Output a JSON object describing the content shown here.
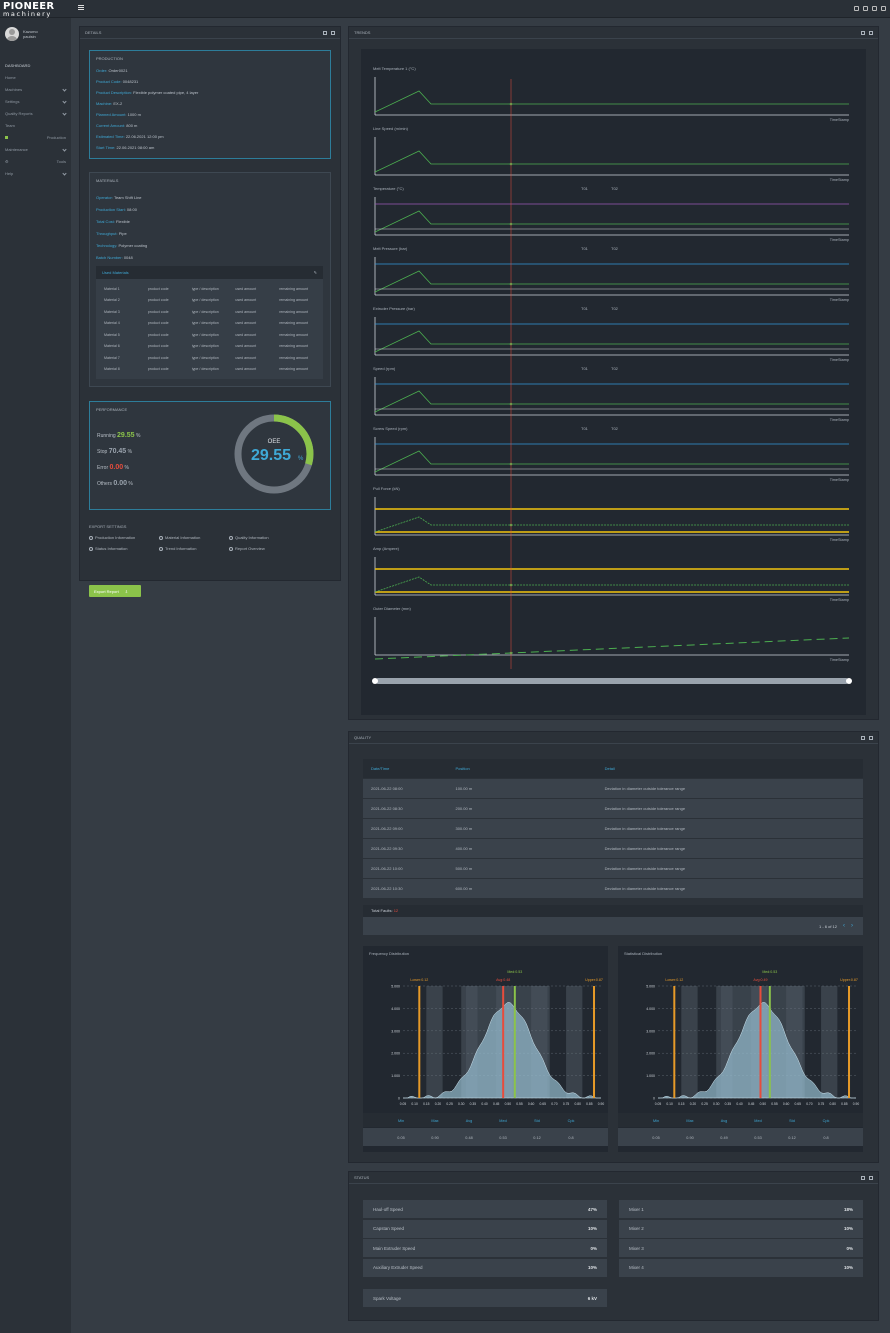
{
  "brand": {
    "line1": "PIONEER",
    "line2": "machinery"
  },
  "user": {
    "name_line1": "Kazumo",
    "name_line2": "paulsin"
  },
  "sidebar": {
    "items": [
      {
        "label": "DASHBOARD",
        "kind": "section"
      },
      {
        "label": "Home"
      },
      {
        "label": "Machines",
        "chev": true
      },
      {
        "label": "Settings",
        "chev": true
      },
      {
        "label": "Quality Reports",
        "chev": true
      },
      {
        "label": "Team"
      },
      {
        "label": "Production",
        "kind": "active"
      },
      {
        "label": "Maintenance",
        "chev": true
      },
      {
        "label": "Tools",
        "kind": "gear"
      },
      {
        "label": "Help",
        "chev": true
      }
    ]
  },
  "panels": {
    "details": "DETAILS",
    "trends": "TRENDS",
    "quality": "QUALITY",
    "status": "STATUS"
  },
  "production": {
    "title": "PRODUCTION",
    "rows": [
      {
        "k": "Order:",
        "v": "Order0021"
      },
      {
        "k": "Product Code:",
        "v": "0048231"
      },
      {
        "k": "Product Description:",
        "v": "Flexible polymer coated pipe, 4 layer"
      },
      {
        "k": "Machine:",
        "v": "EX-2"
      },
      {
        "k": "Planned Amount:",
        "v": "1000 m"
      },
      {
        "k": "Current Amount:",
        "v": "800 m"
      },
      {
        "k": "Estimated Time:",
        "v": "22.06.2021 12:00 pm"
      },
      {
        "k": "Start Time:",
        "v": "22.06.2021 08:00 am"
      }
    ]
  },
  "materials": {
    "title": "MATERIALS",
    "rows": [
      {
        "k": "Operator:",
        "v": "Team Shift Line"
      },
      {
        "k": "Production Start:",
        "v": "08:00"
      },
      {
        "k": "Total Cost:",
        "v": "Flexible"
      },
      {
        "k": "Throughput:",
        "v": "Pipe"
      },
      {
        "k": "Technology:",
        "v": "Polymer coating"
      },
      {
        "k": "Batch Number:",
        "v": "0048"
      }
    ],
    "table_title": "Used Materials",
    "table_rows": [
      [
        "Material 1",
        "product code",
        "type / description",
        "used amount",
        "remaining amount"
      ],
      [
        "Material 2",
        "product code",
        "type / description",
        "used amount",
        "remaining amount"
      ],
      [
        "Material 3",
        "product code",
        "type / description",
        "used amount",
        "remaining amount"
      ],
      [
        "Material 4",
        "product code",
        "type / description",
        "used amount",
        "remaining amount"
      ],
      [
        "Material 5",
        "product code",
        "type / description",
        "used amount",
        "remaining amount"
      ],
      [
        "Material 6",
        "product code",
        "type / description",
        "used amount",
        "remaining amount"
      ],
      [
        "Material 7",
        "product code",
        "type / description",
        "used amount",
        "remaining amount"
      ],
      [
        "Material 8",
        "product code",
        "type / description",
        "used amount",
        "remaining amount"
      ]
    ]
  },
  "performance": {
    "title": "PERFORMANCE",
    "rows": [
      {
        "k": "Running",
        "v": "29.55",
        "u": "%",
        "color": "#8bc34a"
      },
      {
        "k": "Stop",
        "v": "70.45",
        "u": "%",
        "color": "#9aa3ad"
      },
      {
        "k": "Error",
        "v": "0.00",
        "u": "%",
        "color": "#e74c3c"
      },
      {
        "k": "Others",
        "v": "0.00",
        "u": "%",
        "color": "#9aa3ad"
      }
    ],
    "oee_label": "OEE",
    "oee_value": "29.55",
    "oee_unit": "%",
    "oee_fraction": 0.2955
  },
  "export": {
    "title": "EXPORT SETTINGS",
    "options": [
      "Production Information",
      "Material Information",
      "Quality Information",
      "Status Information",
      "Trend Information",
      "Report Overview"
    ],
    "button": "Export Report"
  },
  "trends": {
    "charts": [
      {
        "label": "Melt Temperature 1 (°C)",
        "type": "single"
      },
      {
        "label": "Line Speed (m/min)",
        "type": "single"
      },
      {
        "label": "Temperature (°C)",
        "type": "multi",
        "legend": [
          "T01",
          "T02"
        ]
      },
      {
        "label": "Melt Pressure (bar)",
        "type": "multi",
        "legend": [
          "T01",
          "T02"
        ]
      },
      {
        "label": "Extruder Pressure (bar)",
        "type": "multi",
        "legend": [
          "T01",
          "T02"
        ]
      },
      {
        "label": "Speed (rpm)",
        "type": "multi",
        "legend": [
          "T01",
          "T02"
        ]
      },
      {
        "label": "Screw Speed (rpm)",
        "type": "multi",
        "legend": [
          "T01",
          "T02"
        ]
      },
      {
        "label": "Pull Force (kN)",
        "type": "yellow"
      },
      {
        "label": "Amp (Ampere)",
        "type": "yellow"
      },
      {
        "label": "Outer Diameter (mm)",
        "type": "dash"
      }
    ],
    "xlabel": "TimeStamp"
  },
  "quality": {
    "headers": [
      "Date/Time",
      "Position",
      "Detail"
    ],
    "rows": [
      [
        "2021-06-22 08:00",
        "100.00 m",
        "Deviation in diameter outside tolerance range"
      ],
      [
        "2021-06-22 08:30",
        "200.00 m",
        "Deviation in diameter outside tolerance range"
      ],
      [
        "2021-06-22 09:00",
        "300.00 m",
        "Deviation in diameter outside tolerance range"
      ],
      [
        "2021-06-22 09:30",
        "400.00 m",
        "Deviation in diameter outside tolerance range"
      ],
      [
        "2021-06-22 10:00",
        "500.00 m",
        "Deviation in diameter outside tolerance range"
      ],
      [
        "2021-06-22 10:30",
        "600.00 m",
        "Deviation in diameter outside tolerance range"
      ]
    ],
    "total_label": "Total Faults:",
    "total_value": "12",
    "pagination": "1 - 6 of 12"
  },
  "chart_data": [
    {
      "type": "area",
      "title": "Frequency Distribution",
      "annotations": [
        "Lower:0.12",
        "Avg:0.48",
        "Med:0.53",
        "Upper:0.87"
      ],
      "yticks": [
        "5.000",
        "4.000",
        "3.000",
        "2.000",
        "1.000",
        "0"
      ],
      "xticks": [
        "0.05",
        "0.10",
        "0.15",
        "0.20",
        "0.25",
        "0.30",
        "0.35",
        "0.40",
        "0.45",
        "0.50",
        "0.55",
        "0.60",
        "0.65",
        "0.70",
        "0.75",
        "0.80",
        "0.85",
        "0.90"
      ],
      "stats_headers": [
        "Min",
        "Max",
        "Avg",
        "Med",
        "Std",
        "Cpk"
      ],
      "stats_values": [
        "0.05",
        "0.90",
        "0.48",
        "0.53",
        "0.12",
        "0.8"
      ]
    },
    {
      "type": "area",
      "title": "Statistical Distribution",
      "annotations": [
        "Lower:0.12",
        "Avg:0.49",
        "Med:0.53",
        "Upper:0.87"
      ],
      "yticks": [
        "5.000",
        "4.000",
        "3.000",
        "2.000",
        "1.000",
        "0"
      ],
      "xticks": [
        "0.05",
        "0.10",
        "0.15",
        "0.20",
        "0.25",
        "0.30",
        "0.35",
        "0.40",
        "0.45",
        "0.50",
        "0.55",
        "0.60",
        "0.65",
        "0.70",
        "0.75",
        "0.80",
        "0.85",
        "0.90"
      ],
      "stats_headers": [
        "Min",
        "Max",
        "Avg",
        "Med",
        "Std",
        "Cpk"
      ],
      "stats_values": [
        "0.05",
        "0.90",
        "0.49",
        "0.53",
        "0.12",
        "0.8"
      ]
    }
  ],
  "status": {
    "left": [
      {
        "k": "Haul-off Speed",
        "v": "47%"
      },
      {
        "k": "Capstan Speed",
        "v": "10%"
      },
      {
        "k": "Main Extruder Speed",
        "v": "0%"
      },
      {
        "k": "Auxiliary Extruder Speed",
        "v": "10%"
      }
    ],
    "right": [
      {
        "k": "Mixer 1",
        "v": "18%"
      },
      {
        "k": "Mixer 2",
        "v": "10%"
      },
      {
        "k": "Mixer 3",
        "v": "0%"
      },
      {
        "k": "Mixer 4",
        "v": "10%"
      }
    ],
    "extra": {
      "k": "Spark Voltage",
      "v": "6 kV"
    }
  }
}
